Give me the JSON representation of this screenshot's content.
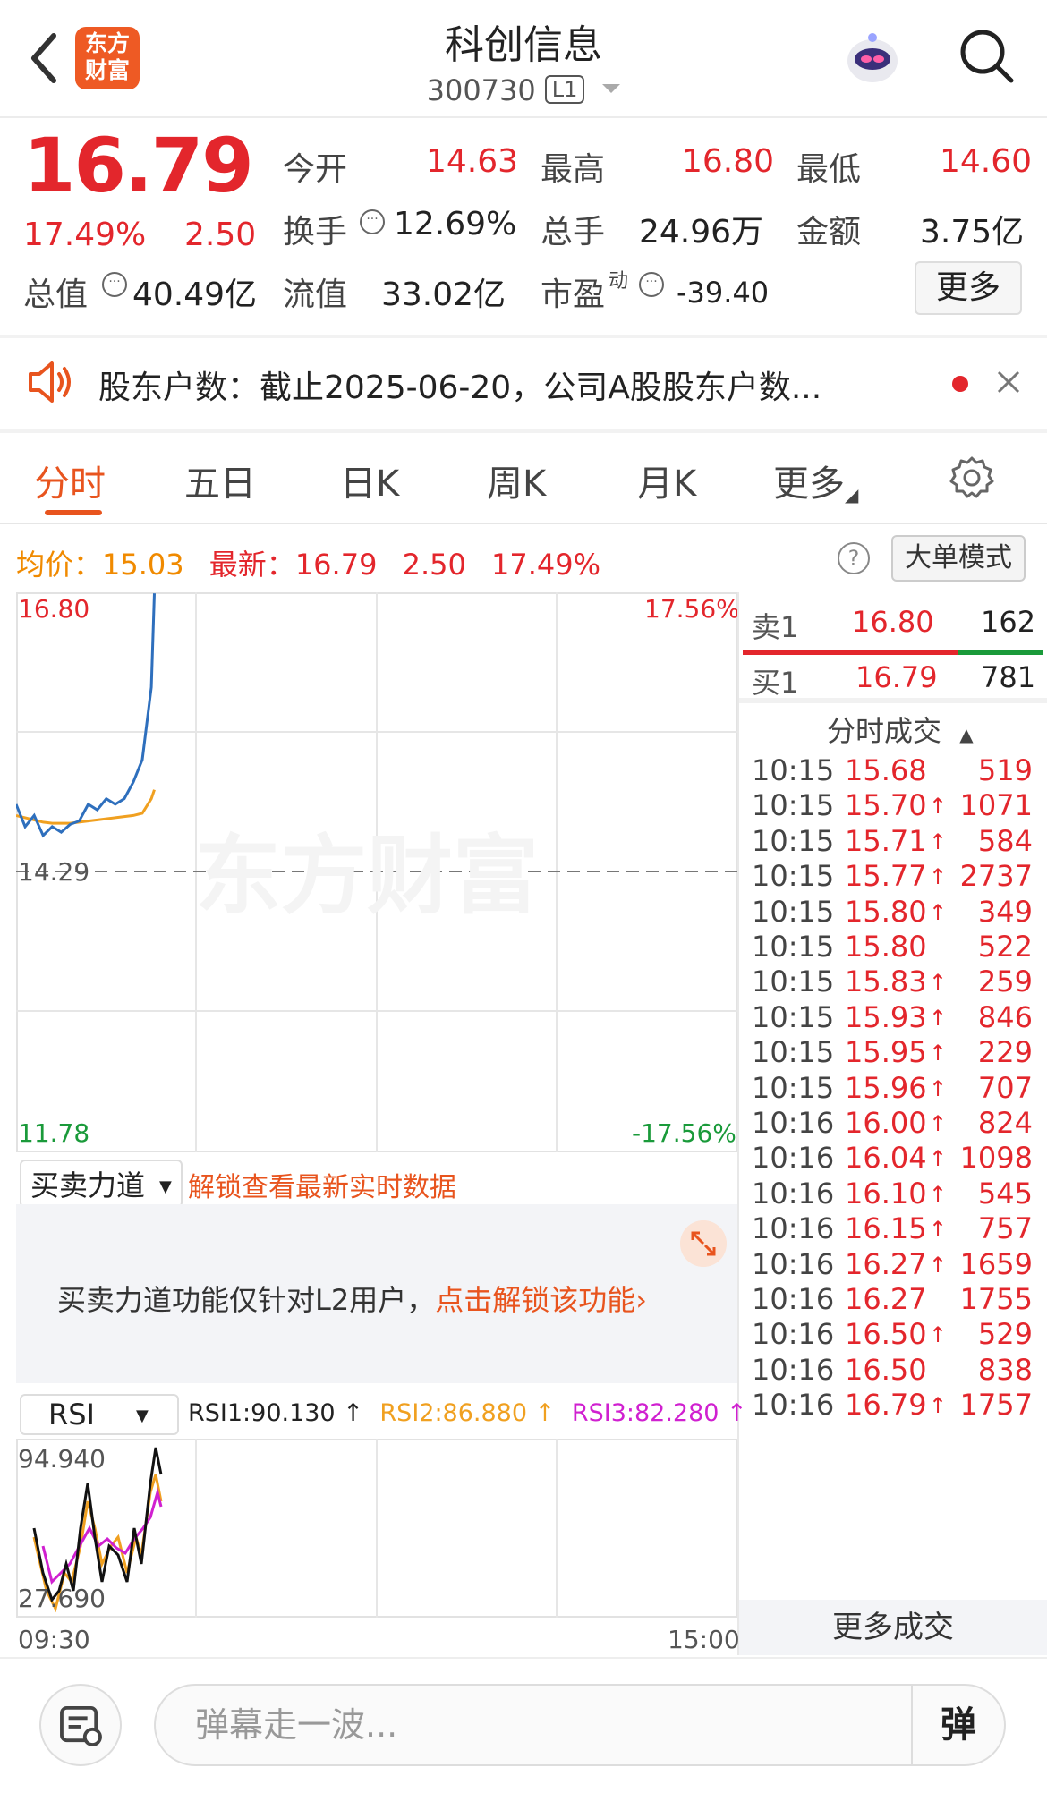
{
  "header": {
    "title": "科创信息",
    "code": "300730",
    "level_badge": "L1",
    "logo_text_1": "东方",
    "logo_text_2": "财富"
  },
  "quote": {
    "price": "16.79",
    "change_pct": "17.49%",
    "change": "2.50",
    "open_label": "今开",
    "open": "14.63",
    "high_label": "最高",
    "high": "16.80",
    "low_label": "最低",
    "low": "14.60",
    "turnover_label": "换手",
    "turnover": "12.69%",
    "volume_label": "总手",
    "volume": "24.96万",
    "amount_label": "金额",
    "amount": "3.75亿",
    "mktcap_label": "总值",
    "mktcap": "40.49亿",
    "float_label": "流值",
    "float": "33.02亿",
    "pe_label": "市盈",
    "pe_sup": "动",
    "pe": "-39.40",
    "more": "更多"
  },
  "notice": {
    "text": "股东户数：截止2025-06-20，公司A股股东户数..."
  },
  "tabs": [
    "分时",
    "五日",
    "日K",
    "周K",
    "月K",
    "更多"
  ],
  "chart_header": {
    "avg_label": "均价：",
    "avg": "15.03",
    "latest_label": "最新：",
    "latest": "16.79",
    "latest_change": "2.50",
    "latest_pct": "17.49%",
    "help": "?",
    "mode_button": "大单模式"
  },
  "chart": {
    "y_top": "16.80",
    "y_mid": "14.29",
    "y_bottom": "11.78",
    "pct_top": "17.56%",
    "pct_bottom": "-17.56%",
    "watermark": "东方财富",
    "x_start": "09:30",
    "x_end": "15:00"
  },
  "chart_data": {
    "type": "line",
    "title": "",
    "xlabel": "",
    "ylabel": "",
    "ylim": [
      11.78,
      16.8
    ],
    "prev_close": 14.29,
    "x": [
      "09:30",
      "09:33",
      "09:36",
      "09:39",
      "09:42",
      "09:45",
      "09:48",
      "09:51",
      "09:54",
      "09:57",
      "10:00",
      "10:03",
      "10:06",
      "10:09",
      "10:12",
      "10:15",
      "10:16"
    ],
    "series": [
      {
        "values": [
          14.9,
          14.7,
          14.8,
          14.62,
          14.7,
          14.65,
          14.72,
          14.75,
          14.9,
          14.85,
          14.95,
          14.9,
          14.95,
          15.1,
          15.3,
          15.95,
          16.79
        ]
      },
      {
        "values": [
          14.8,
          14.78,
          14.76,
          14.74,
          14.73,
          14.73,
          14.73,
          14.74,
          14.75,
          14.76,
          14.77,
          14.78,
          14.79,
          14.8,
          14.82,
          14.95,
          15.03
        ]
      }
    ]
  },
  "orderbook": {
    "sell1_label": "卖1",
    "sell1_price": "16.80",
    "sell1_vol": "162",
    "buy1_label": "买1",
    "buy1_price": "16.79",
    "buy1_vol": "781"
  },
  "ticks_title": "分时成交",
  "ticks": [
    {
      "time": "10:15",
      "price": "15.68",
      "arrow": "",
      "vol": "519"
    },
    {
      "time": "10:15",
      "price": "15.70",
      "arrow": "↑",
      "vol": "1071"
    },
    {
      "time": "10:15",
      "price": "15.71",
      "arrow": "↑",
      "vol": "584"
    },
    {
      "time": "10:15",
      "price": "15.77",
      "arrow": "↑",
      "vol": "2737"
    },
    {
      "time": "10:15",
      "price": "15.80",
      "arrow": "↑",
      "vol": "349"
    },
    {
      "time": "10:15",
      "price": "15.80",
      "arrow": "",
      "vol": "522"
    },
    {
      "time": "10:15",
      "price": "15.83",
      "arrow": "↑",
      "vol": "259"
    },
    {
      "time": "10:15",
      "price": "15.93",
      "arrow": "↑",
      "vol": "846"
    },
    {
      "time": "10:15",
      "price": "15.95",
      "arrow": "↑",
      "vol": "229"
    },
    {
      "time": "10:15",
      "price": "15.96",
      "arrow": "↑",
      "vol": "707"
    },
    {
      "time": "10:16",
      "price": "16.00",
      "arrow": "↑",
      "vol": "824"
    },
    {
      "time": "10:16",
      "price": "16.04",
      "arrow": "↑",
      "vol": "1098"
    },
    {
      "time": "10:16",
      "price": "16.10",
      "arrow": "↑",
      "vol": "545"
    },
    {
      "time": "10:16",
      "price": "16.15",
      "arrow": "↑",
      "vol": "757"
    },
    {
      "time": "10:16",
      "price": "16.27",
      "arrow": "↑",
      "vol": "1659"
    },
    {
      "time": "10:16",
      "price": "16.27",
      "arrow": "",
      "vol": "1755"
    },
    {
      "time": "10:16",
      "price": "16.50",
      "arrow": "↑",
      "vol": "529"
    },
    {
      "time": "10:16",
      "price": "16.50",
      "arrow": "",
      "vol": "838"
    },
    {
      "time": "10:16",
      "price": "16.79",
      "arrow": "↑",
      "vol": "1757"
    }
  ],
  "more_ticks": "更多成交",
  "indicators": {
    "force_select": "买卖力道",
    "unlock_link": "解锁查看最新实时数据",
    "l2_notice": "买卖力道功能仅针对L2用户，",
    "l2_link": "点击解锁该功能",
    "rsi_select": "RSI",
    "rsi1": "RSI1:90.130 ↑",
    "rsi2": "RSI2:86.880 ↑",
    "rsi3": "RSI3:82.280 ↑",
    "rsi_top": "94.940",
    "rsi_bottom": "27.690"
  },
  "bottom": {
    "placeholder": "弹幕走一波...",
    "danmu_button": "弹"
  },
  "colors": {
    "up": "#e3262c",
    "down": "#1a9a3a",
    "accent": "#e8541e",
    "avg": "#f0a020",
    "price_line": "#2e6fbd"
  }
}
